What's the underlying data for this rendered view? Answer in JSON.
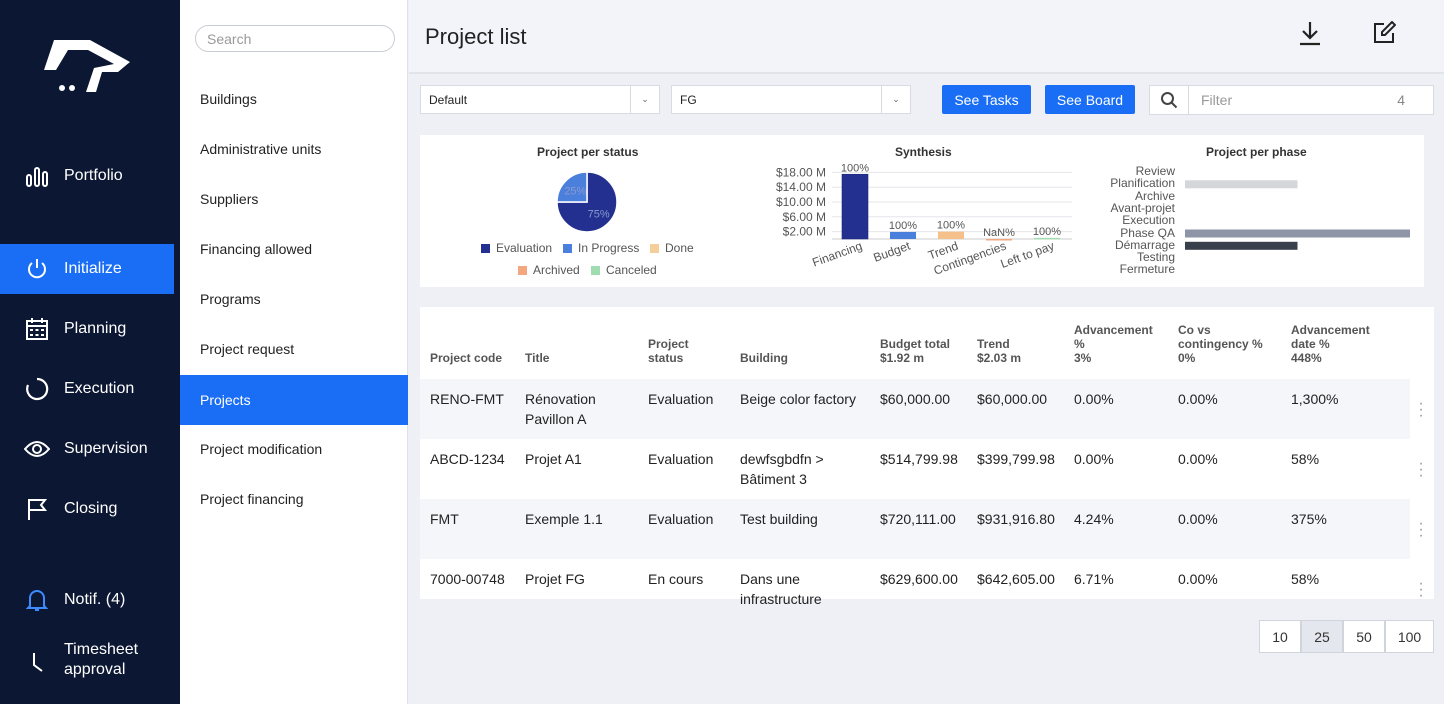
{
  "nav": {
    "items": [
      {
        "label": "Portfolio",
        "icon": "bar-chart-icon"
      },
      {
        "label": "Initialize",
        "icon": "power-icon"
      },
      {
        "label": "Planning",
        "icon": "calendar-icon"
      },
      {
        "label": "Execution",
        "icon": "progress-circle-icon"
      },
      {
        "label": "Supervision",
        "icon": "eye-icon"
      },
      {
        "label": "Closing",
        "icon": "flag-icon"
      },
      {
        "label": "Notif. (4)",
        "icon": "bell-icon"
      },
      {
        "label": "Timesheet approval",
        "icon": "clock-icon"
      }
    ]
  },
  "submenu": {
    "search_placeholder": "Search",
    "items": [
      "Buildings",
      "Administrative units",
      "Suppliers",
      "Financing allowed",
      "Programs",
      "Project request",
      "Projects",
      "Project modification",
      "Project financing"
    ]
  },
  "header": {
    "title": "Project list"
  },
  "toolbar": {
    "view_select": "Default",
    "group_select": "FG",
    "see_tasks": "See Tasks",
    "see_board": "See Board",
    "filter_placeholder": "Filter",
    "filter_count": "4"
  },
  "charts": {
    "status": {
      "title": "Project per status",
      "slices": [
        {
          "name": "Evaluation",
          "pct": 75,
          "label": "75%",
          "color": "#23308f"
        },
        {
          "name": "In Progress",
          "pct": 25,
          "label": "25%",
          "color": "#4a7fdc"
        }
      ],
      "legend": [
        {
          "name": "Evaluation",
          "color": "#23308f"
        },
        {
          "name": "In Progress",
          "color": "#4a7fdc"
        },
        {
          "name": "Done",
          "color": "#f5cf9a"
        },
        {
          "name": "Archived",
          "color": "#f2a77e"
        },
        {
          "name": "Canceled",
          "color": "#9fdcb0"
        }
      ]
    },
    "synthesis": {
      "title": "Synthesis",
      "yticks": [
        "$18.00 M",
        "$14.00 M",
        "$10.00 M",
        "$6.00 M",
        "$2.00 M"
      ],
      "bars": [
        {
          "category": "Financing",
          "value": 17.5,
          "label": "100%",
          "color": "#23308f"
        },
        {
          "category": "Budget",
          "value": 1.9,
          "label": "100%",
          "color": "#4a7fdc"
        },
        {
          "category": "Trend",
          "value": 2.0,
          "label": "100%",
          "color": "#f5c08a"
        },
        {
          "category": "Contingencies",
          "value": 0,
          "label": "NaN%",
          "color": "#f2a77e"
        },
        {
          "category": "Left to pay",
          "value": 0.3,
          "label": "100%",
          "color": "#9fdcb0"
        }
      ],
      "ymax": 20
    },
    "phase": {
      "title": "Project per phase",
      "phases": [
        {
          "name": "Review",
          "value": 0
        },
        {
          "name": "Planification",
          "value": 1
        },
        {
          "name": "Archive",
          "value": 0
        },
        {
          "name": "Avant-projet",
          "value": 0
        },
        {
          "name": "Execution",
          "value": 0
        },
        {
          "name": "Phase QA",
          "value": 2
        },
        {
          "name": "Démarrage",
          "value": 1
        },
        {
          "name": "Testing",
          "value": 0
        },
        {
          "name": "Fermeture",
          "value": 0
        }
      ],
      "colors": {
        "Planification": "#d4d6da",
        "Phase QA": "#8e95a6",
        "Démarrage": "#3a3f4c"
      },
      "max": 2
    }
  },
  "table": {
    "columns": [
      {
        "label": "Project code"
      },
      {
        "label": "Title"
      },
      {
        "label": "Project status"
      },
      {
        "label": "Building"
      },
      {
        "label": "Budget total",
        "sub": "$1.92 m"
      },
      {
        "label": "Trend",
        "sub": "$2.03 m"
      },
      {
        "label": "Advancement %",
        "sub": "3%"
      },
      {
        "label": "Co vs contingency %",
        "sub": "0%"
      },
      {
        "label": "Advancement date %",
        "sub": "448%"
      }
    ],
    "rows": [
      [
        "RENO-FMT",
        "Rénovation Pavillon A",
        "Evaluation",
        "Beige color factory",
        "$60,000.00",
        "$60,000.00",
        "0.00%",
        "0.00%",
        "1,300%"
      ],
      [
        "ABCD-1234",
        "Projet A1",
        "Evaluation",
        "dewfsgbdfn > Bâtiment 3",
        "$514,799.98",
        "$399,799.98",
        "0.00%",
        "0.00%",
        "58%"
      ],
      [
        "FMT",
        "Exemple 1.1",
        "Evaluation",
        "Test building",
        "$720,111.00",
        "$931,916.80",
        "4.24%",
        "0.00%",
        "375%"
      ],
      [
        "7000-00748",
        "Projet FG",
        "En cours",
        "Dans une infrastructure",
        "$629,600.00",
        "$642,605.00",
        "6.71%",
        "0.00%",
        "58%"
      ]
    ]
  },
  "pagination": {
    "sizes": [
      "10",
      "25",
      "50",
      "100"
    ],
    "selected": "25"
  }
}
